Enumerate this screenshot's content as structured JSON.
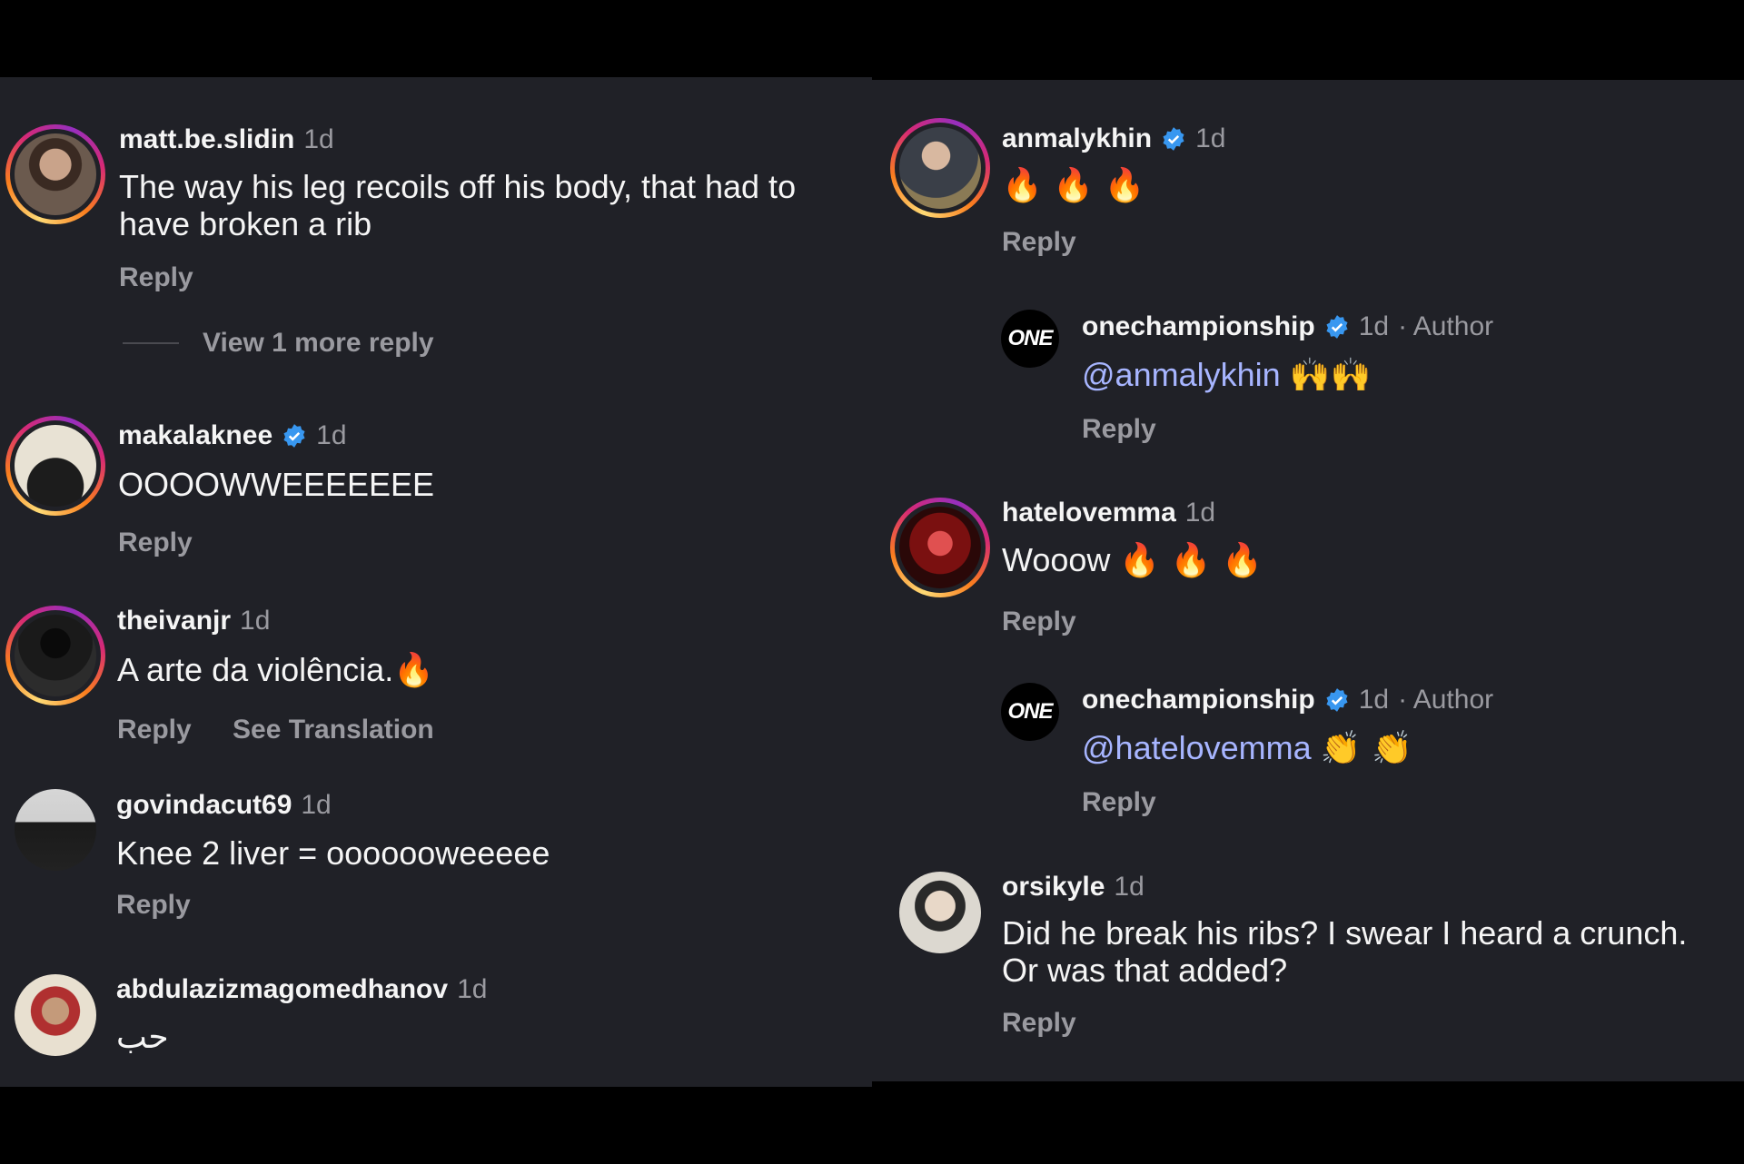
{
  "left": {
    "comments": [
      {
        "username": "matt.be.slidin",
        "time": "1d",
        "text": "The way his leg recoils off his body, that had to have broken a rib",
        "reply": "Reply",
        "view_more": "View 1 more reply"
      },
      {
        "username": "makalaknee",
        "time": "1d",
        "verified": true,
        "text": "OOOOWWEEEEEEE",
        "reply": "Reply"
      },
      {
        "username": "theivanjr",
        "time": "1d",
        "text": "A arte da violência.",
        "emoji": "🔥",
        "reply": "Reply",
        "see_translation": "See Translation"
      },
      {
        "username": "govindacut69",
        "time": "1d",
        "text": "Knee 2 liver = ooooooweeeee",
        "reply": "Reply"
      },
      {
        "username": "abdulazizmagomedhanov",
        "time": "1d",
        "text": "حب"
      }
    ]
  },
  "right": {
    "comments": [
      {
        "username": "anmalykhin",
        "time": "1d",
        "verified": true,
        "emoji": "🔥 🔥 🔥",
        "reply": "Reply"
      },
      {
        "username": "onechampionship",
        "time": "1d",
        "author": "· Author",
        "verified": true,
        "mention": "@anmalykhin",
        "emoji": "🙌🙌",
        "reply": "Reply",
        "logo": "ONE"
      },
      {
        "username": "hatelovemma",
        "time": "1d",
        "text": "Wooow",
        "emoji": "🔥 🔥 🔥",
        "reply": "Reply"
      },
      {
        "username": "onechampionship",
        "time": "1d",
        "author": "· Author",
        "verified": true,
        "mention": "@hatelovemma",
        "emoji": "👏 👏",
        "reply": "Reply",
        "logo": "ONE"
      },
      {
        "username": "orsikyle",
        "time": "1d",
        "text_line1": "Did he break his ribs? I swear I heard a crunch.",
        "text_line2": "Or was that added?",
        "reply": "Reply"
      }
    ]
  },
  "colors": {
    "background": "#202127",
    "secondary_text": "#9a9aa0",
    "mention": "#a7b5ff",
    "verified": "#3897f0"
  }
}
